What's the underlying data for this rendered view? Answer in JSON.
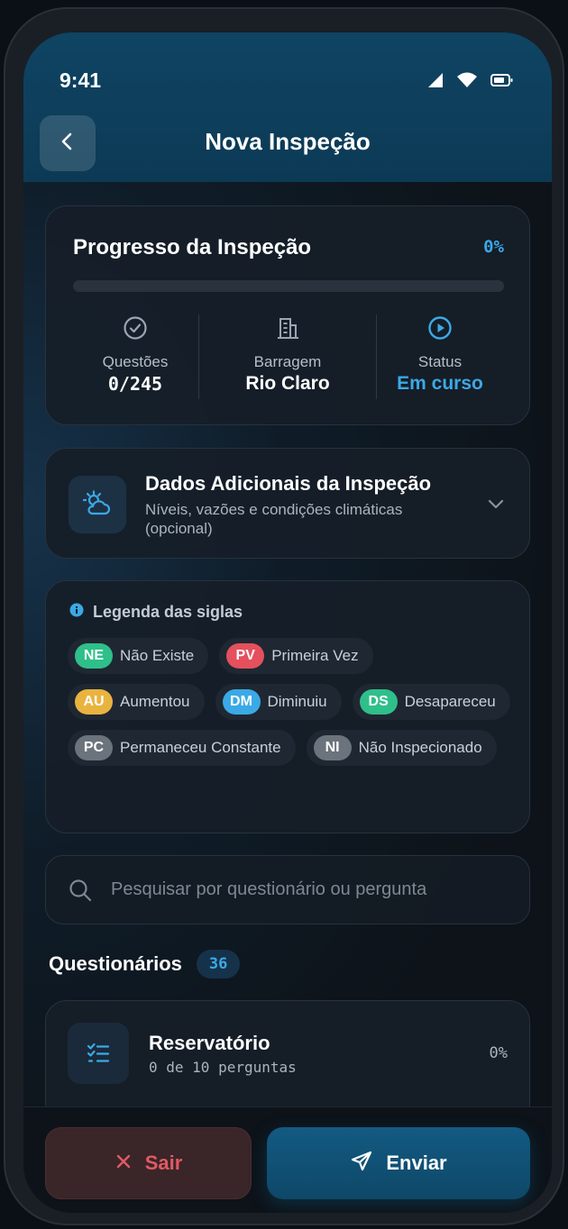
{
  "status_bar": {
    "time": "9:41"
  },
  "header": {
    "title": "Nova Inspeção"
  },
  "progress": {
    "title": "Progresso da Inspeção",
    "percent_label": "0%",
    "fraction": 0.0,
    "questions": {
      "label": "Questões",
      "value": "0/245"
    },
    "dam": {
      "label": "Barragem",
      "value": "Rio Claro"
    },
    "status": {
      "label": "Status",
      "value": "Em curso"
    }
  },
  "extra": {
    "title": "Dados Adicionais da Inspeção",
    "subtitle": "Níveis, vazões e condições climáticas (opcional)"
  },
  "legend": {
    "title": "Legenda das siglas",
    "items": [
      {
        "code": "NE",
        "label": "Não Existe",
        "color": "#2fbf8a"
      },
      {
        "code": "PV",
        "label": "Primeira Vez",
        "color": "#e4505e"
      },
      {
        "code": "AU",
        "label": "Aumentou",
        "color": "#e9b33f"
      },
      {
        "code": "DM",
        "label": "Diminuiu",
        "color": "#3ba9e6"
      },
      {
        "code": "DS",
        "label": "Desapareceu",
        "color": "#2fbf8a"
      },
      {
        "code": "PC",
        "label": "Permaneceu Constante",
        "color": "#6b737c"
      },
      {
        "code": "NI",
        "label": "Não Inspecionado",
        "color": "#6b737c"
      }
    ]
  },
  "search": {
    "placeholder": "Pesquisar por questionário ou pergunta"
  },
  "questionnaires": {
    "title": "Questionários",
    "count": "36",
    "items": [
      {
        "title": "Reservatório",
        "subtitle": "0 de 10 perguntas",
        "percent": "0%"
      }
    ]
  },
  "actions": {
    "exit_label": "Sair",
    "send_label": "Enviar"
  },
  "colors": {
    "accent": "#3ba9e6",
    "danger": "#e05a64"
  }
}
